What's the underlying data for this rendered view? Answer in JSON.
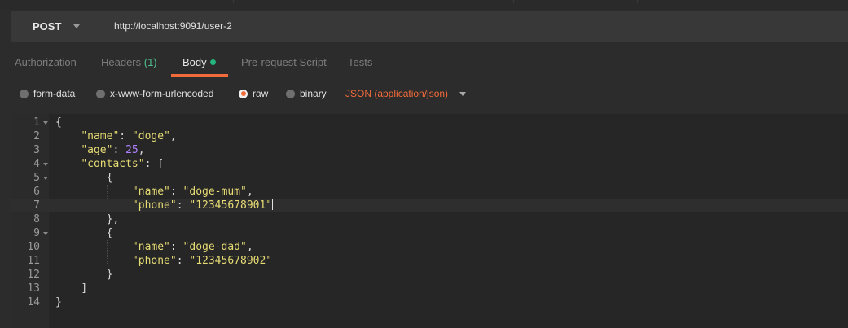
{
  "request": {
    "method": "POST",
    "url": "http://localhost:9091/user-2"
  },
  "tabs": [
    {
      "label": "Authorization"
    },
    {
      "label": "Headers ",
      "count": "(1)"
    },
    {
      "label": "Body"
    },
    {
      "label": "Pre-request Script"
    },
    {
      "label": "Tests"
    }
  ],
  "active_tab": "Body",
  "body_types": [
    {
      "label": "form-data",
      "selected": false
    },
    {
      "label": "x-www-form-urlencoded",
      "selected": false
    },
    {
      "label": "raw",
      "selected": true
    },
    {
      "label": "binary",
      "selected": false
    }
  ],
  "content_type": "JSON (application/json)",
  "editor": {
    "line_numbers": [
      "1",
      "2",
      "3",
      "4",
      "5",
      "6",
      "7",
      "8",
      "9",
      "10",
      "11",
      "12",
      "13",
      "14"
    ],
    "lines": [
      "{",
      "    \"name\": \"doge\",",
      "    \"age\": 25,",
      "    \"contacts\": [",
      "        {",
      "            \"name\": \"doge-mum\",",
      "            \"phone\": \"12345678901\"",
      "        },",
      "        {",
      "            \"name\": \"doge-dad\",",
      "            \"phone\": \"12345678902\"",
      "        }",
      "    ]",
      "}"
    ],
    "current_line": 7,
    "foldable_lines": [
      1,
      4,
      5,
      9
    ]
  },
  "colors": {
    "accent": "#f26b3a",
    "dot_green": "#26b47f",
    "json_string": "#e6db74",
    "json_number": "#ae81ff"
  }
}
